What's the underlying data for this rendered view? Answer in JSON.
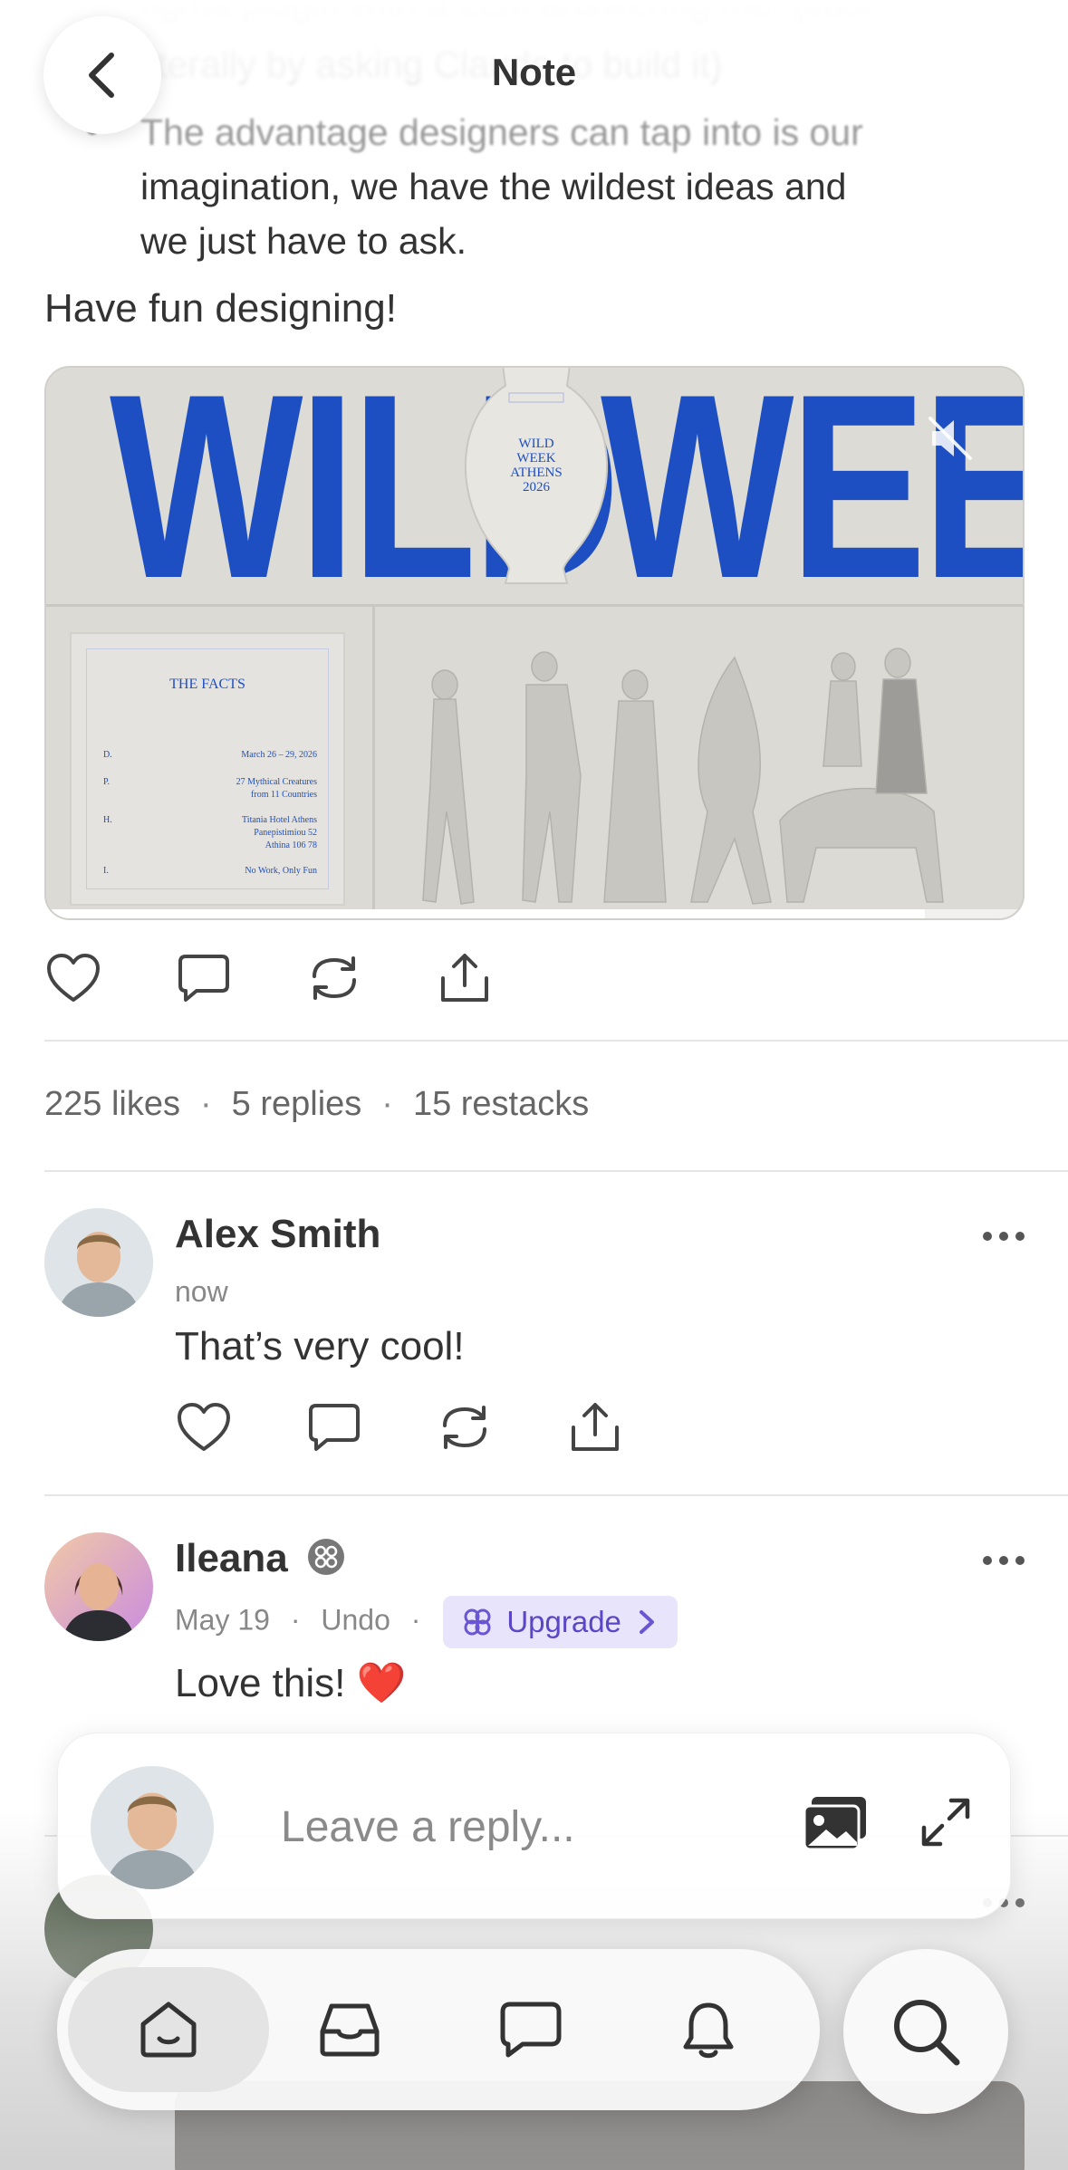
{
  "header": {
    "title": "Note",
    "blurred_lines": [
      "figma plugin with a LLM answering me. (Just",
      "literally by asking Claude to build it)"
    ]
  },
  "post": {
    "bullet_text": [
      "The advantage designers can tap into is our",
      "imagination, we have the wildest ideas and",
      "we just have to ask."
    ],
    "closing": "Have fun designing!",
    "media": {
      "headline_left": "WILD",
      "headline_right": "WEEK",
      "vase_text": [
        "WILD",
        "WEEK",
        "ATHENS",
        "2026"
      ],
      "facts_title": "THE FACTS",
      "facts": [
        {
          "key": "D.",
          "value": "March 26 – 29, 2026"
        },
        {
          "key": "P.",
          "value": "27 Mythical Creatures\nfrom 11 Countries"
        },
        {
          "key": "H.",
          "value": "Titania Hotel Athens\nPanepistimiou 52\nAthina 106 78"
        },
        {
          "key": "I.",
          "value": "No Work, Only Fun"
        }
      ],
      "muted": true,
      "progress": 0.9
    },
    "actions": [
      "like-icon",
      "reply-icon",
      "restack-icon",
      "share-icon"
    ]
  },
  "stats": {
    "likes": "225 likes",
    "replies": "5 replies",
    "restacks": "15 restacks",
    "separator": "·"
  },
  "comments": [
    {
      "name": "Alex Smith",
      "time": "now",
      "body": "That’s very cool!"
    },
    {
      "name": "Ileana",
      "time": "May 19",
      "undo": "Undo",
      "separator": "·",
      "upgrade_label": "Upgrade",
      "body": "Love this! ❤️"
    }
  ],
  "composer": {
    "placeholder": "Leave a reply..."
  },
  "tabbar": {
    "items": [
      "home-icon",
      "inbox-icon",
      "chat-icon",
      "notifications-icon"
    ],
    "active": "home-icon",
    "search": "search-icon"
  },
  "colors": {
    "accent_blue": "#1d4fc2",
    "upgrade_bg": "#e8e4fb",
    "upgrade_fg": "#5b46c7",
    "heart_red": "#e0282e"
  }
}
